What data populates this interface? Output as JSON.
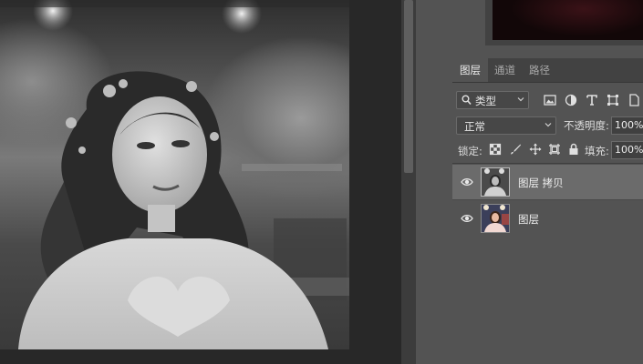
{
  "panel": {
    "tabs": [
      {
        "label": "图层",
        "active": true
      },
      {
        "label": "通道",
        "active": false
      },
      {
        "label": "路径",
        "active": false
      }
    ],
    "filter": {
      "kind_label": "类型"
    },
    "blend_mode": "正常",
    "opacity_label": "不透明度:",
    "opacity_value": "100%",
    "lock_label": "锁定:",
    "fill_label": "填充:",
    "fill_value": "100%"
  },
  "layers": [
    {
      "name": "图层  拷贝",
      "visible": true,
      "selected": true,
      "thumbnail": "grayscale-portrait"
    },
    {
      "name": "图层",
      "visible": true,
      "selected": false,
      "thumbnail": "color-portrait"
    }
  ],
  "icons": {
    "visibility": "eye-icon",
    "search": "search-icon",
    "filter_pixel": "image-filter-icon",
    "filter_adjust": "adjustment-filter-icon",
    "filter_type": "type-filter-icon",
    "filter_shape": "shape-filter-icon",
    "lock_pixels": "lock-transparent-pixels-icon",
    "lock_paint": "lock-image-pixels-icon",
    "lock_move": "lock-position-icon",
    "lock_artboard": "lock-artboard-icon",
    "lock_all": "lock-all-icon"
  },
  "colors": {
    "panel_bg": "#535353",
    "selected_layer": "#6b6b6b",
    "canvas_bg": "#282828"
  }
}
